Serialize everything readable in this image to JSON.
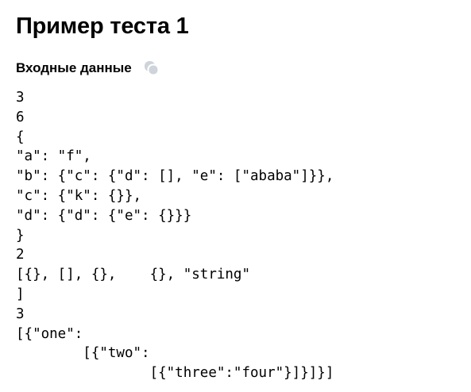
{
  "page": {
    "title": "Пример теста 1"
  },
  "input_section": {
    "label": "Входные данные",
    "copy_icon": "copy-icon",
    "icon_color": "#cfd4da"
  },
  "input_content": "3\n6\n{\n\"a\": \"f\",\n\"b\": {\"c\": {\"d\": [], \"e\": [\"ababa\"]}},\n\"c\": {\"k\": {}},\n\"d\": {\"d\": {\"e\": {}}}\n}\n2\n[{}, [], {},    {}, \"string\"\n]\n3\n[{\"one\":\n        [{\"two\":\n                [{\"three\":\"four\"}]}]}]"
}
